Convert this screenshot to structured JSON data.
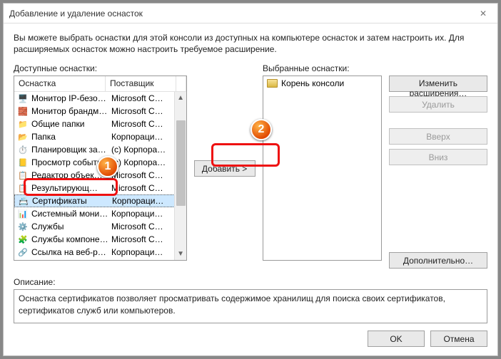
{
  "window": {
    "title": "Добавление и удаление оснасток"
  },
  "intro": "Вы можете выбрать оснастки для этой консоли из доступных на компьютере оснасток и затем настроить их. Для расширяемых оснасток можно настроить требуемое расширение.",
  "avail": {
    "label": "Доступные оснастки:",
    "headers": {
      "snapin": "Оснастка",
      "vendor": "Поставщик"
    },
    "items": [
      {
        "icon": "🖥️",
        "name": "Монитор IP-безоп…",
        "vendor": "Microsoft C…",
        "selected": false
      },
      {
        "icon": "🧱",
        "name": "Монитор брандм…",
        "vendor": "Microsoft C…",
        "selected": false
      },
      {
        "icon": "📁",
        "name": "Общие папки",
        "vendor": "Microsoft C…",
        "selected": false
      },
      {
        "icon": "📂",
        "name": "Папка",
        "vendor": "Корпораци…",
        "selected": false
      },
      {
        "icon": "⏱️",
        "name": "Планировщик за…",
        "vendor": "(c) Корпора…",
        "selected": false
      },
      {
        "icon": "📒",
        "name": "Просмотр событий",
        "vendor": "(c) Корпора…",
        "selected": false
      },
      {
        "icon": "📋",
        "name": "Редактор объек…",
        "vendor": "Microsoft C…",
        "selected": false
      },
      {
        "icon": "📋",
        "name": "Результирующ…",
        "vendor": "Microsoft C…",
        "selected": false
      },
      {
        "icon": "📇",
        "name": "Сертификаты",
        "vendor": "Корпораци…",
        "selected": true
      },
      {
        "icon": "📊",
        "name": "Системный мони…",
        "vendor": "Корпораци…",
        "selected": false
      },
      {
        "icon": "⚙️",
        "name": "Службы",
        "vendor": "Microsoft C…",
        "selected": false
      },
      {
        "icon": "🧩",
        "name": "Службы компоне…",
        "vendor": "Microsoft C…",
        "selected": false
      },
      {
        "icon": "🔗",
        "name": "Ссылка на веб-р…",
        "vendor": "Корпораци…",
        "selected": false
      }
    ]
  },
  "selected": {
    "label": "Выбранные оснастки:",
    "root": "Корень консоли"
  },
  "buttons": {
    "add": "Добавить >",
    "edit_ext": "Изменить расширения…",
    "remove": "Удалить",
    "up": "Вверх",
    "down": "Вниз",
    "advanced": "Дополнительно…",
    "ok": "OK",
    "cancel": "Отмена"
  },
  "desc": {
    "label": "Описание:",
    "text": "Оснастка сертификатов позволяет просматривать содержимое хранилищ для поиска своих сертификатов, сертификатов служб или компьютеров."
  },
  "callouts": {
    "one": "1",
    "two": "2"
  }
}
